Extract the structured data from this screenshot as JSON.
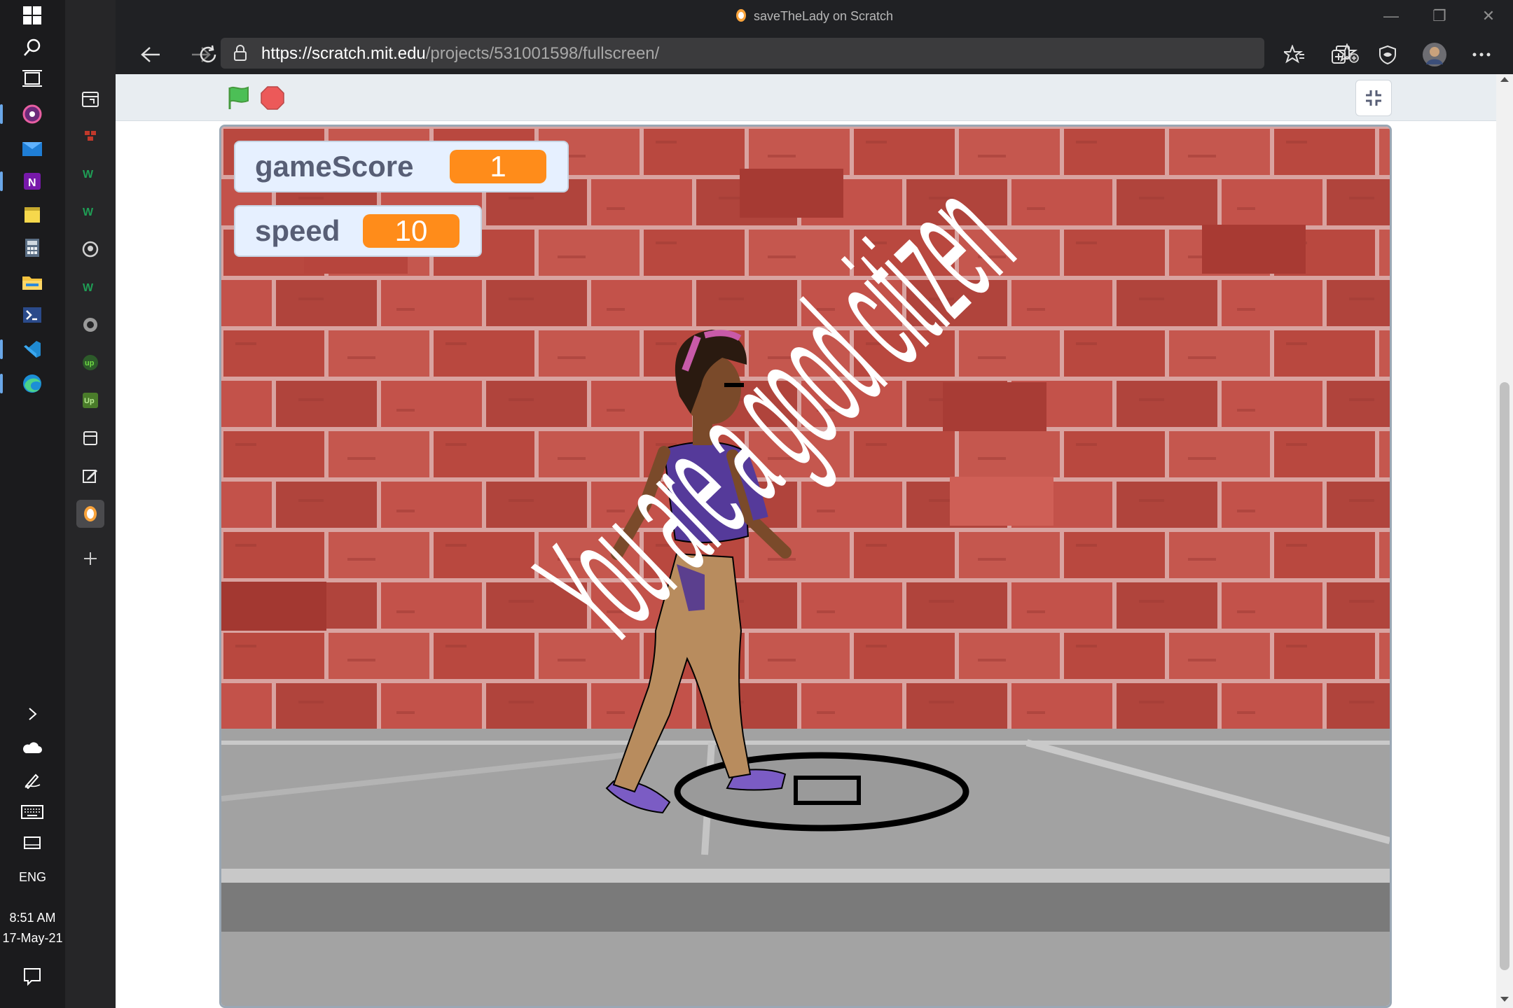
{
  "taskbar": {
    "language": "ENG",
    "time": "8:51 AM",
    "date": "17-May-21"
  },
  "browser": {
    "window_title": "saveTheLady on Scratch",
    "url_host": "https://scratch.mit.edu",
    "url_path": "/projects/531001598/fullscreen/"
  },
  "monitors": [
    {
      "label": "gameScore",
      "value": "1"
    },
    {
      "label": "speed",
      "value": "10"
    }
  ],
  "stage": {
    "message": "You are a good citizen"
  },
  "colors": {
    "monitor_value": "#ff8c1a",
    "brick": "#b4463f",
    "sidewalk": "#9a9a9a",
    "green_flag": "#4cbf56",
    "stop": "#ec5959"
  }
}
